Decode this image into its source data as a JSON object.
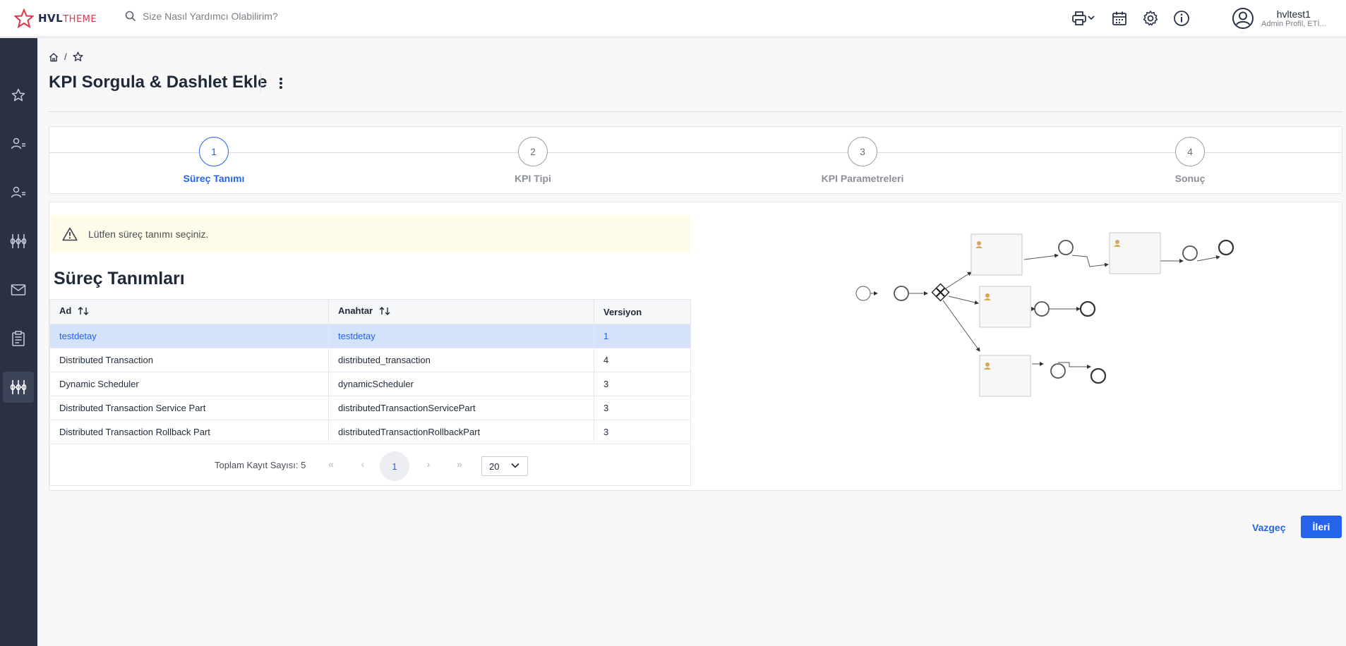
{
  "brand": {
    "name": "HVL",
    "suffix": "THEME"
  },
  "search": {
    "placeholder": "Size Nasıl Yardımcı Olabilirim?"
  },
  "user": {
    "name": "hvltest1",
    "role": "Admin Profil, ETİ..."
  },
  "header_icons": [
    "printer-icon",
    "calendar-icon",
    "gear-icon",
    "info-icon"
  ],
  "sidebar": {
    "items": [
      "star-icon",
      "users-icon",
      "user-group-icon",
      "network-icon",
      "mail-icon",
      "clipboard-icon",
      "network-active-icon"
    ]
  },
  "breadcrumb": {
    "separator": "/"
  },
  "page": {
    "title": "KPI Sorgula & Dashlet Ekle"
  },
  "stepper": {
    "steps": [
      {
        "number": "1",
        "label": "Süreç Tanımı",
        "active": true
      },
      {
        "number": "2",
        "label": "KPI Tipi",
        "active": false
      },
      {
        "number": "3",
        "label": "KPI Parametreleri",
        "active": false
      },
      {
        "number": "4",
        "label": "Sonuç",
        "active": false
      }
    ]
  },
  "alert": {
    "text": "Lütfen süreç tanımı seçiniz."
  },
  "section": {
    "title": "Süreç Tanımları"
  },
  "table": {
    "columns": [
      "Ad",
      "Anahtar",
      "Versiyon"
    ],
    "rows": [
      {
        "ad": "testdetay",
        "anahtar": "testdetay",
        "versiyon": "1",
        "selected": true
      },
      {
        "ad": "Distributed Transaction",
        "anahtar": "distributed_transaction",
        "versiyon": "4"
      },
      {
        "ad": "Dynamic Scheduler",
        "anahtar": "dynamicScheduler",
        "versiyon": "3"
      },
      {
        "ad": "Distributed Transaction Service Part",
        "anahtar": "distributedTransactionServicePart",
        "versiyon": "3"
      },
      {
        "ad": "Distributed Transaction Rollback Part",
        "anahtar": "distributedTransactionRollbackPart",
        "versiyon": "3"
      }
    ]
  },
  "pager": {
    "total": "Toplam Kayıt Sayısı: 5",
    "current_page": "1",
    "page_size": "20"
  },
  "actions": {
    "cancel": "Vazgeç",
    "next": "İleri"
  },
  "colors": {
    "accent": "#2563eb",
    "sidebar": "#2b3142",
    "alert_bg": "#fefbe8",
    "selected_row": "#d4e2fb",
    "brand_red": "#e0354b"
  }
}
